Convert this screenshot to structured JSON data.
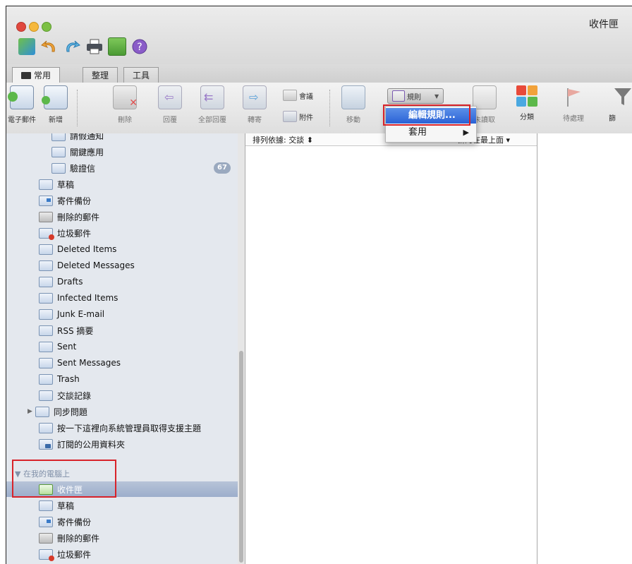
{
  "window": {
    "title": "收件匣"
  },
  "tabs": [
    {
      "label": "常用"
    },
    {
      "label": "整理"
    },
    {
      "label": "工具"
    }
  ],
  "ribbon": {
    "email": "電子郵件",
    "new": "新增",
    "delete": "刪除",
    "reply": "回覆",
    "reply_all": "全部回覆",
    "forward": "轉寄",
    "meeting": "會議",
    "attachment": "附件",
    "move": "移動",
    "rules": "規則",
    "unread": "未讀取",
    "categorize": "分類",
    "follow_up": "待處理",
    "filter": "篩"
  },
  "rules_menu": {
    "edit_rules": "編輯規則...",
    "apply": "套用",
    "apply_arrow": "▶"
  },
  "sort_bar": {
    "sort_by": "排列依據: 交談 ⬍",
    "order": "新的在最上面 ▾"
  },
  "sidebar": {
    "server_folders": [
      {
        "label": "請假通知"
      },
      {
        "label": "關鍵應用"
      },
      {
        "label": "驗證信",
        "badge": "67"
      },
      {
        "label": "草稿"
      },
      {
        "label": "寄件備份"
      },
      {
        "label": "刪除的郵件"
      },
      {
        "label": "垃圾郵件"
      },
      {
        "label": "Deleted Items"
      },
      {
        "label": "Deleted Messages"
      },
      {
        "label": "Drafts"
      },
      {
        "label": "Infected Items"
      },
      {
        "label": "Junk E-mail"
      },
      {
        "label": "RSS 摘要"
      },
      {
        "label": "Sent"
      },
      {
        "label": "Sent Messages"
      },
      {
        "label": "Trash"
      },
      {
        "label": "交談記錄"
      },
      {
        "label": "同步問題"
      },
      {
        "label": "按一下這裡向系統管理員取得支援主題"
      },
      {
        "label": "訂閱的公用資料夾"
      }
    ],
    "section_label": "▼ 在我的電腦上",
    "local_folders": [
      {
        "label": "收件匣"
      },
      {
        "label": "草稿"
      },
      {
        "label": "寄件備份"
      },
      {
        "label": "刪除的郵件"
      },
      {
        "label": "垃圾郵件"
      }
    ],
    "expand_arrow": "▶"
  },
  "colors": {
    "highlight_red": "#d8232a",
    "selection_blue": "#2a62d6",
    "sidebar_bg": "#e4e8ee"
  }
}
